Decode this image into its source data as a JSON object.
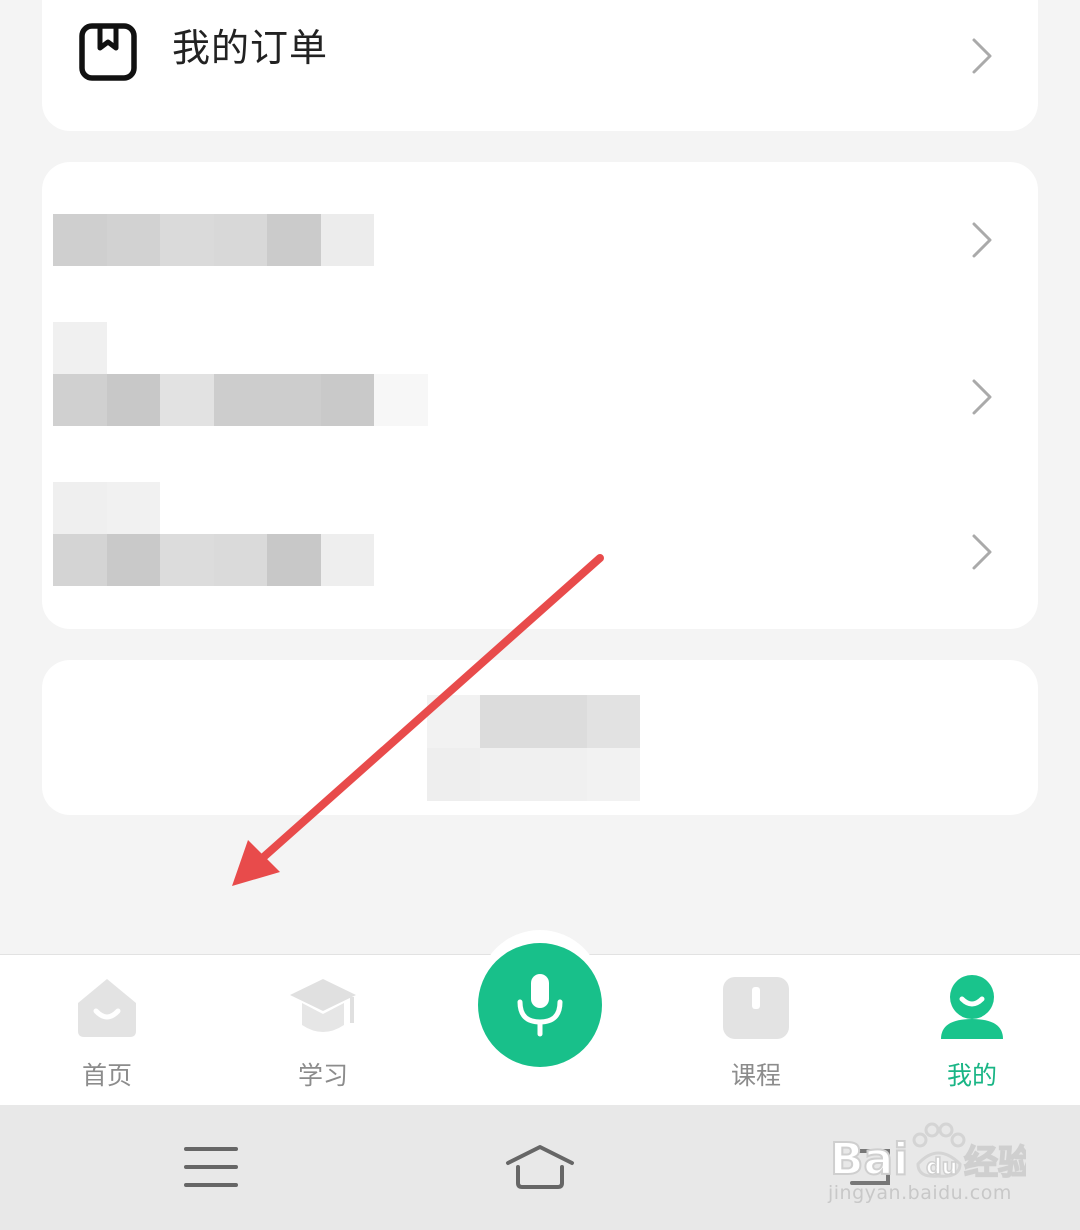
{
  "orders": {
    "label": "我的订单"
  },
  "nav": {
    "items": [
      {
        "label": "首页",
        "active": false
      },
      {
        "label": "学习",
        "active": false
      },
      {
        "label": "课程",
        "active": false
      },
      {
        "label": "我的",
        "active": true
      }
    ]
  },
  "colors": {
    "accent": "#18c08a",
    "active_label": "#19b585",
    "inactive": "#8c8c8c",
    "annotation_arrow": "#e84b4b"
  },
  "watermark": {
    "text": "jingyan.baidu.com"
  }
}
